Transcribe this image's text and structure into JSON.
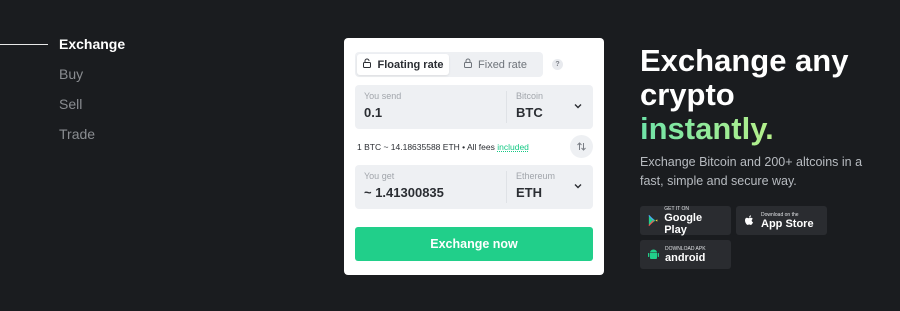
{
  "nav": {
    "items": [
      {
        "label": "Exchange",
        "active": true
      },
      {
        "label": "Buy",
        "active": false
      },
      {
        "label": "Sell",
        "active": false
      },
      {
        "label": "Trade",
        "active": false
      }
    ]
  },
  "card": {
    "tabs": {
      "floating": "Floating rate",
      "fixed": "Fixed rate",
      "help": "?"
    },
    "send": {
      "label": "You send",
      "value": "0.1",
      "currency_name": "Bitcoin",
      "currency_code": "BTC"
    },
    "rate": {
      "text": "1 BTC ~ 14.18635588 ETH • All fees ",
      "link": "included"
    },
    "get": {
      "label": "You get",
      "value": "~ 1.41300835",
      "currency_name": "Ethereum",
      "currency_code": "ETH"
    },
    "button": "Exchange now"
  },
  "hero": {
    "line1": "Exchange any",
    "line2": "crypto",
    "line3": "instantly.",
    "subtitle": "Exchange Bitcoin and 200+ altcoins in a fast, simple and secure way."
  },
  "badges": {
    "google": {
      "small": "GET IT ON",
      "big": "Google Play"
    },
    "apple": {
      "small": "Download on the",
      "big": "App Store"
    },
    "android": {
      "small": "DOWNLOAD APK",
      "big": "android"
    }
  },
  "colors": {
    "background": "#1a1c1f",
    "accent": "#21cf8a",
    "card": "#ffffff"
  }
}
